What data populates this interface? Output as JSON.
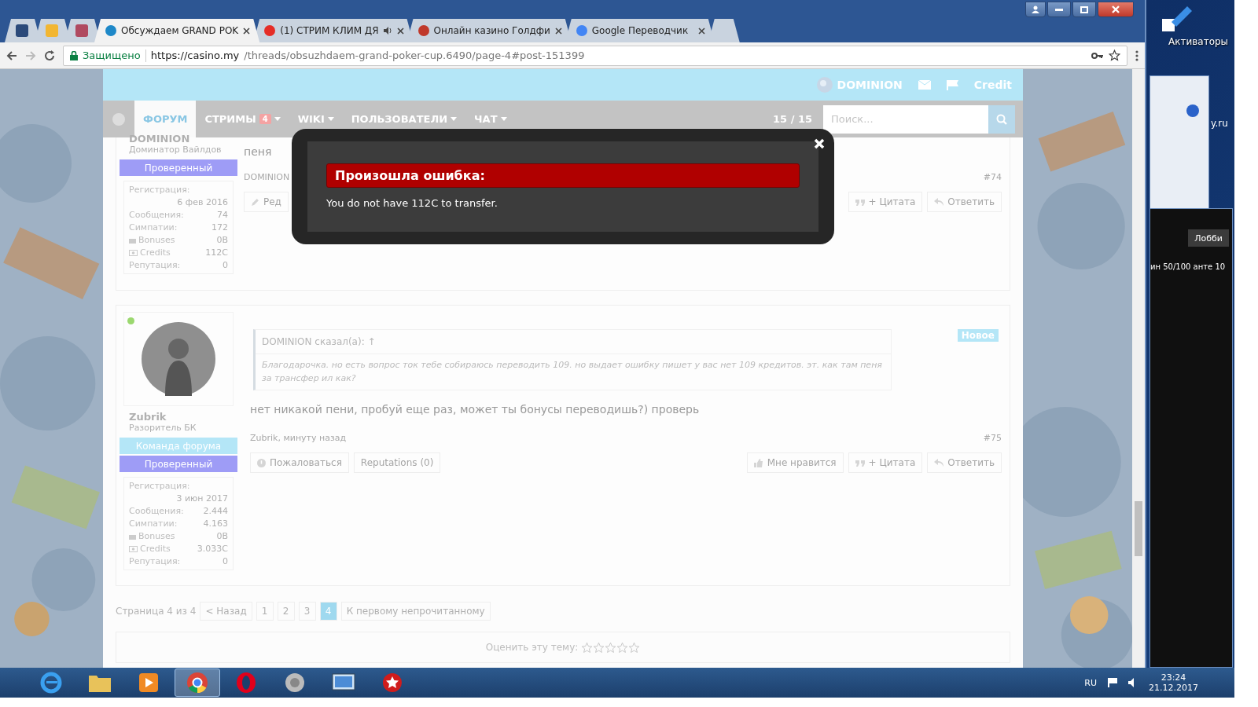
{
  "browser": {
    "tabs": [
      {
        "title": "Обсуждаем GRAND POK",
        "selected": true,
        "audio": false
      },
      {
        "title": "(1) СТРИМ КЛИМ ДЯ",
        "selected": false,
        "audio": true
      },
      {
        "title": "Онлайн казино Голдфи",
        "selected": false,
        "audio": false
      },
      {
        "title": "Google Переводчик",
        "selected": false,
        "audio": false
      }
    ],
    "address": {
      "secure_label": "Защищено",
      "url_host": "https://casino.my",
      "url_path": "/threads/obsuzhdaem-grand-poker-cup.6490/page-4#post-151399"
    }
  },
  "header": {
    "user": "DOMINION",
    "credit": "Credit"
  },
  "nav": {
    "items": [
      {
        "label": "ФОРУМ",
        "selected": true
      },
      {
        "label": "СТРИМЫ",
        "badge": "4",
        "selected": false
      },
      {
        "label": "WIKI",
        "selected": false
      },
      {
        "label": "ПОЛЬЗОВАТЕЛИ",
        "selected": false
      },
      {
        "label": "ЧАТ",
        "selected": false
      }
    ],
    "page_counter": "15 / 15",
    "search": {
      "placeholder": "Поиск..."
    }
  },
  "posts": [
    {
      "author": "DOMINION",
      "user_title": "Доминатор Вайлдов",
      "badges": [
        {
          "label": "Проверенный",
          "kind": "verified"
        }
      ],
      "stats": [
        {
          "label": "Регистрация:",
          "value": "6 фев 2016",
          "kind": "wide"
        },
        {
          "label": "Сообщения:",
          "value": "74",
          "kind": "plain"
        },
        {
          "label": "Симпатии:",
          "value": "172",
          "kind": "plain"
        },
        {
          "label": "Bonuses",
          "value": "0B",
          "kind": "bonus"
        },
        {
          "label": "Credits",
          "value": "112C",
          "kind": "credit"
        },
        {
          "label": "Репутация:",
          "value": "0",
          "kind": "plain"
        }
      ],
      "body": "пеня",
      "meta": "DOMINION",
      "number": "#74",
      "actions_left": [
        {
          "label": "Ред",
          "kind": "edit"
        }
      ],
      "actions_right": [
        {
          "label": "+ Цитата",
          "kind": "quote"
        },
        {
          "label": "Ответить",
          "kind": "reply"
        }
      ]
    },
    {
      "author": "Zubrik",
      "user_title": "Разоритель БК",
      "online": true,
      "badges": [
        {
          "label": "Команда форума",
          "kind": "team"
        },
        {
          "label": "Проверенный",
          "kind": "verified"
        }
      ],
      "stats": [
        {
          "label": "Регистрация:",
          "value": "3 июн 2017",
          "kind": "wide"
        },
        {
          "label": "Сообщения:",
          "value": "2.444",
          "kind": "plain"
        },
        {
          "label": "Симпатии:",
          "value": "4.163",
          "kind": "plain"
        },
        {
          "label": "Bonuses",
          "value": "0B",
          "kind": "bonus"
        },
        {
          "label": "Credits",
          "value": "3.033C",
          "kind": "credit"
        },
        {
          "label": "Репутация:",
          "value": "0",
          "kind": "plain"
        }
      ],
      "quote": {
        "author": "DOMINION сказал(а): ↑",
        "text": "Благодарочка. но есть вопрос ток тебе собираюсь переводить 109. но выдает ошибку пишет у вас нет 109 кредитов. эт. как там пеня за трансфер ил как?"
      },
      "new_label": "Новое",
      "body": "нет никакой пени, пробуй еще раз, может ты бонусы переводишь?) проверь",
      "meta": "Zubrik, минуту назад",
      "number": "#75",
      "actions_left": [
        {
          "label": "Пожаловаться",
          "kind": "report"
        },
        {
          "label": "Reputations (0)",
          "kind": "plain"
        }
      ],
      "actions_right": [
        {
          "label": "Мне нравится",
          "kind": "like"
        },
        {
          "label": "+ Цитата",
          "kind": "quote"
        },
        {
          "label": "Ответить",
          "kind": "reply"
        }
      ]
    }
  ],
  "pagination": {
    "label": "Страница 4 из 4",
    "prev": "< Назад",
    "pages": [
      {
        "label": "1",
        "selected": false
      },
      {
        "label": "2",
        "selected": false
      },
      {
        "label": "3",
        "selected": false
      },
      {
        "label": "4",
        "selected": true
      }
    ],
    "unread": "К первому непрочитанному"
  },
  "rating": {
    "label": "Оценить эту тему:",
    "stars": 0
  },
  "modal": {
    "title": "Произошла ошибка:",
    "message": "You do not have 112C to transfer."
  },
  "desktop": {
    "icon_label": "Активаторы",
    "window_fragment": "y.ru",
    "lobby_button": "Лобби",
    "table_info": "ин 50/100 анте 10"
  },
  "taskbar": {
    "apps": [
      {
        "kind": "ie",
        "selected": false
      },
      {
        "kind": "folder",
        "selected": false
      },
      {
        "kind": "media",
        "selected": false
      },
      {
        "kind": "chrome",
        "selected": true
      },
      {
        "kind": "opera",
        "selected": false
      },
      {
        "kind": "speaker",
        "selected": false
      },
      {
        "kind": "screen",
        "selected": false
      },
      {
        "kind": "poker",
        "selected": false
      }
    ],
    "language": "RU",
    "time": "23:24",
    "date": "21.12.2017"
  }
}
